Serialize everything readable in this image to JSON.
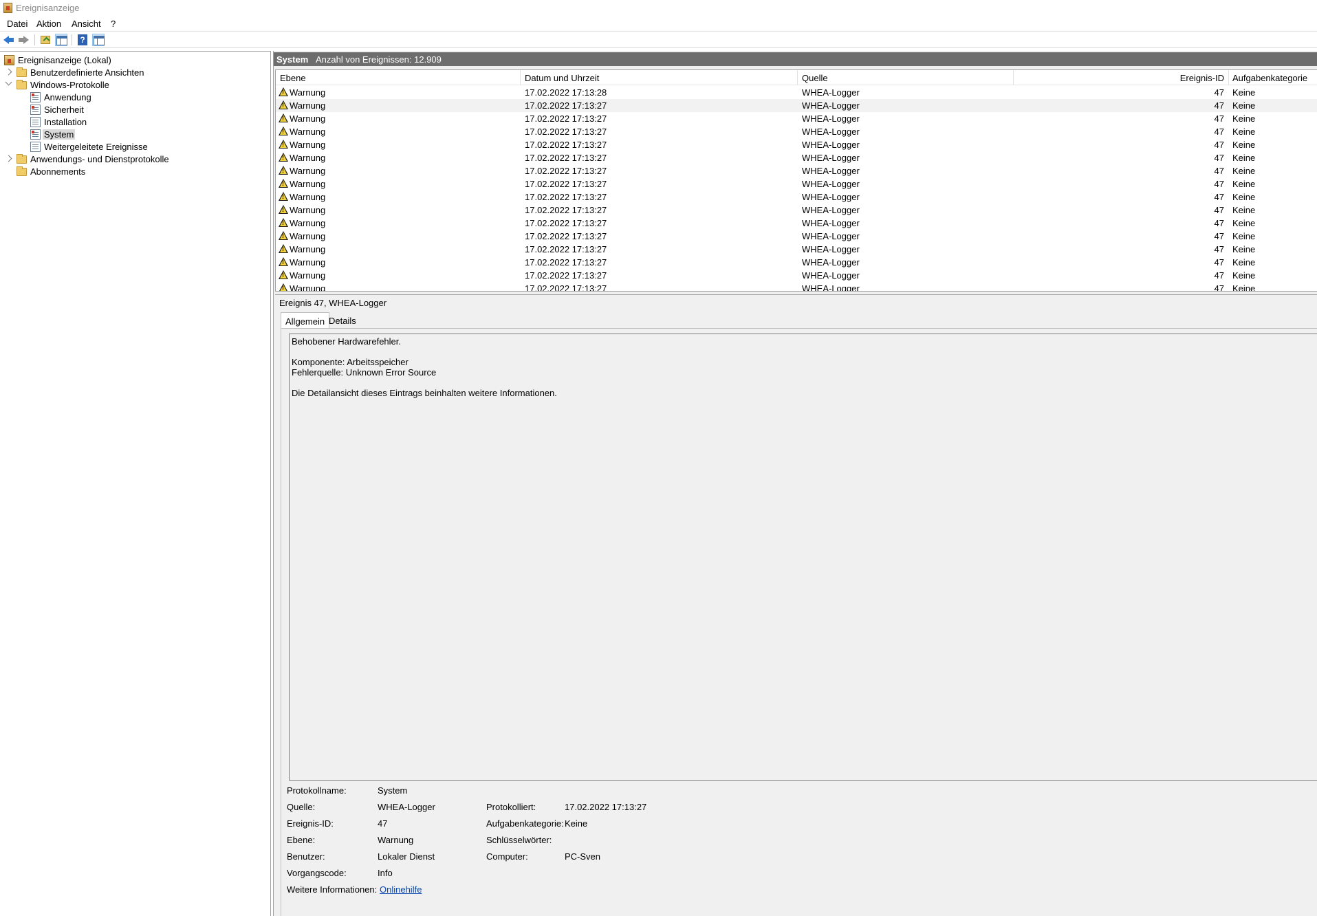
{
  "window": {
    "title": "Ereignisanzeige"
  },
  "menu": [
    "Datei",
    "Aktion",
    "Ansicht",
    "?"
  ],
  "toolbar": {
    "buttons": [
      "back-icon",
      "forward-icon",
      "folder-up-icon",
      "show-hide-tree-icon",
      "help-icon",
      "show-action-pane-icon"
    ]
  },
  "tree": {
    "root": "Ereignisanzeige (Lokal)",
    "custom_views": "Benutzerdefinierte Ansichten",
    "windows_logs": "Windows-Protokolle",
    "logs": [
      "Anwendung",
      "Sicherheit",
      "Installation",
      "System",
      "Weitergeleitete Ereignisse"
    ],
    "app_service_logs": "Anwendungs- und Dienstprotokolle",
    "subscriptions": "Abonnements",
    "selected": "System"
  },
  "log_header": {
    "name": "System",
    "count": "Anzahl von Ereignissen: 12.909"
  },
  "grid": {
    "columns": [
      "Ebene",
      "Datum und Uhrzeit",
      "Quelle",
      "Ereignis-ID",
      "Aufgabenkategorie"
    ],
    "rows": [
      [
        "Warnung",
        "17.02.2022 17:13:28",
        "WHEA-Logger",
        "47",
        "Keine"
      ],
      [
        "Warnung",
        "17.02.2022 17:13:27",
        "WHEA-Logger",
        "47",
        "Keine"
      ],
      [
        "Warnung",
        "17.02.2022 17:13:27",
        "WHEA-Logger",
        "47",
        "Keine"
      ],
      [
        "Warnung",
        "17.02.2022 17:13:27",
        "WHEA-Logger",
        "47",
        "Keine"
      ],
      [
        "Warnung",
        "17.02.2022 17:13:27",
        "WHEA-Logger",
        "47",
        "Keine"
      ],
      [
        "Warnung",
        "17.02.2022 17:13:27",
        "WHEA-Logger",
        "47",
        "Keine"
      ],
      [
        "Warnung",
        "17.02.2022 17:13:27",
        "WHEA-Logger",
        "47",
        "Keine"
      ],
      [
        "Warnung",
        "17.02.2022 17:13:27",
        "WHEA-Logger",
        "47",
        "Keine"
      ],
      [
        "Warnung",
        "17.02.2022 17:13:27",
        "WHEA-Logger",
        "47",
        "Keine"
      ],
      [
        "Warnung",
        "17.02.2022 17:13:27",
        "WHEA-Logger",
        "47",
        "Keine"
      ],
      [
        "Warnung",
        "17.02.2022 17:13:27",
        "WHEA-Logger",
        "47",
        "Keine"
      ],
      [
        "Warnung",
        "17.02.2022 17:13:27",
        "WHEA-Logger",
        "47",
        "Keine"
      ],
      [
        "Warnung",
        "17.02.2022 17:13:27",
        "WHEA-Logger",
        "47",
        "Keine"
      ],
      [
        "Warnung",
        "17.02.2022 17:13:27",
        "WHEA-Logger",
        "47",
        "Keine"
      ],
      [
        "Warnung",
        "17.02.2022 17:13:27",
        "WHEA-Logger",
        "47",
        "Keine"
      ],
      [
        "Warnung",
        "17.02.2022 17:13:27",
        "WHEA-Logger",
        "47",
        "Keine"
      ]
    ],
    "selected_row": 1
  },
  "details": {
    "title": "Ereignis 47, WHEA-Logger",
    "tabs": [
      "Allgemein",
      "Details"
    ],
    "active_tab": "Allgemein",
    "description": {
      "line1": "Behobener Hardwarefehler.",
      "line2": "Komponente: Arbeitsspeicher",
      "line3": "Fehlerquelle: Unknown Error Source",
      "line4": "Die Detailansicht dieses Eintrags beinhalten weitere Informationen."
    },
    "props": {
      "log_name_label": "Protokollname:",
      "log_name": "System",
      "source_label": "Quelle:",
      "source": "WHEA-Logger",
      "logged_label": "Protokolliert:",
      "logged": "17.02.2022 17:13:27",
      "event_id_label": "Ereignis-ID:",
      "event_id": "47",
      "task_cat_label": "Aufgabenkategorie:",
      "task_cat": "Keine",
      "level_label": "Ebene:",
      "level": "Warnung",
      "keywords_label": "Schlüsselwörter:",
      "keywords": "",
      "user_label": "Benutzer:",
      "user": "Lokaler Dienst",
      "computer_label": "Computer:",
      "computer": "PC-Sven",
      "opcode_label": "Vorgangscode:",
      "opcode": "Info",
      "more_info_label": "Weitere Informationen:",
      "more_info_link": "Onlinehilfe"
    }
  }
}
